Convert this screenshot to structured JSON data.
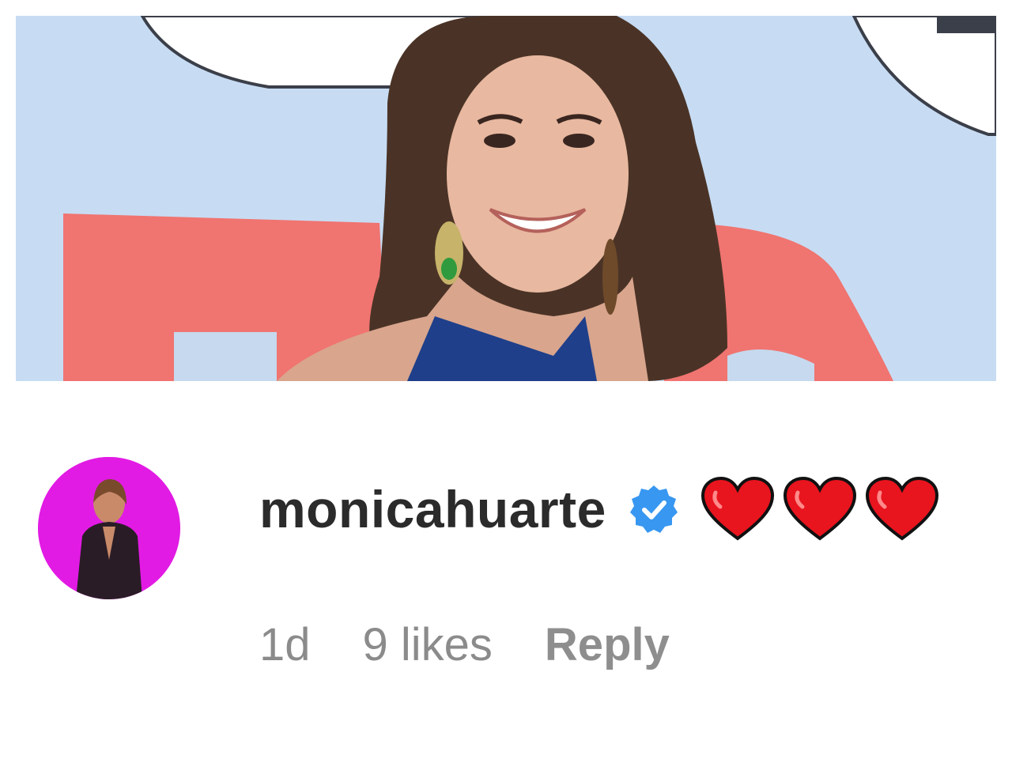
{
  "comment": {
    "username": "monicahuarte",
    "verified": true,
    "text_emojis": [
      "red-heart",
      "red-heart",
      "red-heart"
    ],
    "time": "1d",
    "likes": "9 likes",
    "reply_label": "Reply"
  },
  "colors": {
    "avatar_background": "#e21be4",
    "verified_badge": "#3897f0",
    "heart": "#e8141e",
    "username_text": "#2b2b2b",
    "meta_text": "#8b8b8b"
  },
  "icons": {
    "verified": "verified-badge-icon",
    "heart": "heart-icon"
  }
}
